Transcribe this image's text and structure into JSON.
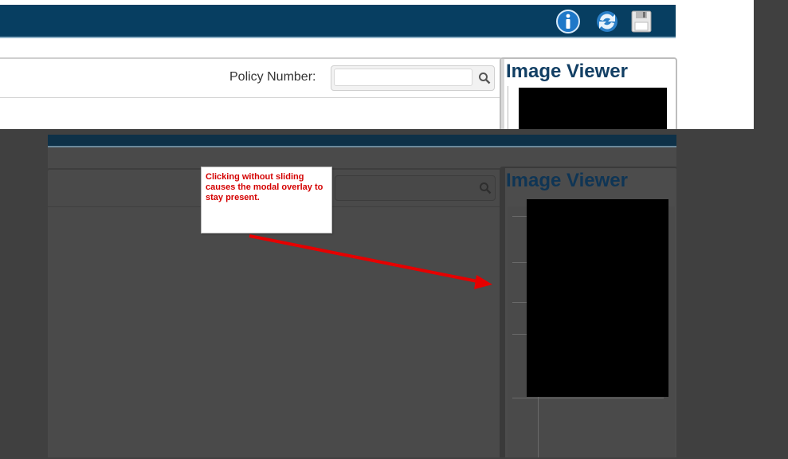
{
  "header": {
    "icons": [
      "info-icon",
      "refresh-icon",
      "save-icon"
    ],
    "bar_color": "#073e61"
  },
  "search": {
    "label": "Policy Number:",
    "value": "",
    "placeholder": ""
  },
  "viewer": {
    "title": "Image Viewer"
  },
  "annotation": {
    "text": "Clicking without sliding causes the modal overlay to stay present.",
    "color": "#d40000"
  },
  "colors": {
    "overlay": "#4a4a4a",
    "redaction": "#000000",
    "title": "#123f64"
  }
}
